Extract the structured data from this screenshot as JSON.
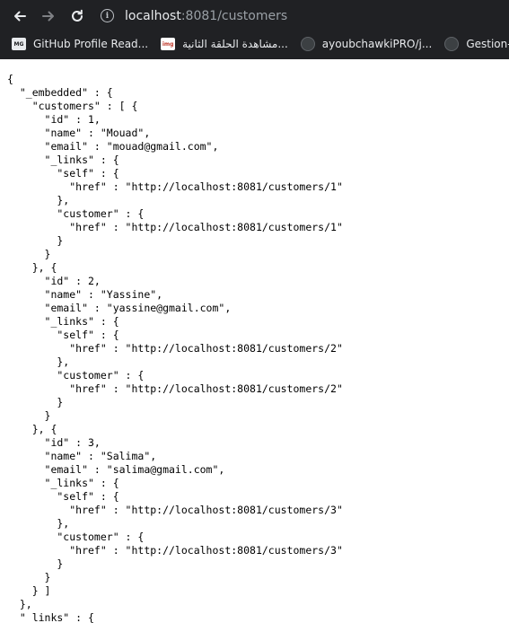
{
  "browser": {
    "url_host": "localhost",
    "url_rest": ":8081/customers",
    "bookmarks": [
      {
        "label": "GitHub Profile Read...",
        "icon": "mg-favicon",
        "favicon_text": "MG"
      },
      {
        "label": "مشاهدة الحلقة الثانية...",
        "icon": "image-favicon",
        "favicon_text": "img"
      },
      {
        "label": "ayoubchawkiPRO/j...",
        "icon": "github-favicon"
      },
      {
        "label": "Gestion-de-sc",
        "icon": "github-favicon"
      }
    ]
  },
  "json_lines": [
    "{",
    "  \"_embedded\" : {",
    "    \"customers\" : [ {",
    "      \"id\" : 1,",
    "      \"name\" : \"Mouad\",",
    "      \"email\" : \"mouad@gmail.com\",",
    "      \"_links\" : {",
    "        \"self\" : {",
    "          \"href\" : \"http://localhost:8081/customers/1\"",
    "        },",
    "        \"customer\" : {",
    "          \"href\" : \"http://localhost:8081/customers/1\"",
    "        }",
    "      }",
    "    }, {",
    "      \"id\" : 2,",
    "      \"name\" : \"Yassine\",",
    "      \"email\" : \"yassine@gmail.com\",",
    "      \"_links\" : {",
    "        \"self\" : {",
    "          \"href\" : \"http://localhost:8081/customers/2\"",
    "        },",
    "        \"customer\" : {",
    "          \"href\" : \"http://localhost:8081/customers/2\"",
    "        }",
    "      }",
    "    }, {",
    "      \"id\" : 3,",
    "      \"name\" : \"Salima\",",
    "      \"email\" : \"salima@gmail.com\",",
    "      \"_links\" : {",
    "        \"self\" : {",
    "          \"href\" : \"http://localhost:8081/customers/3\"",
    "        },",
    "        \"customer\" : {",
    "          \"href\" : \"http://localhost:8081/customers/3\"",
    "        }",
    "      }",
    "    } ]",
    "  },",
    "  \"_links\" : {"
  ]
}
